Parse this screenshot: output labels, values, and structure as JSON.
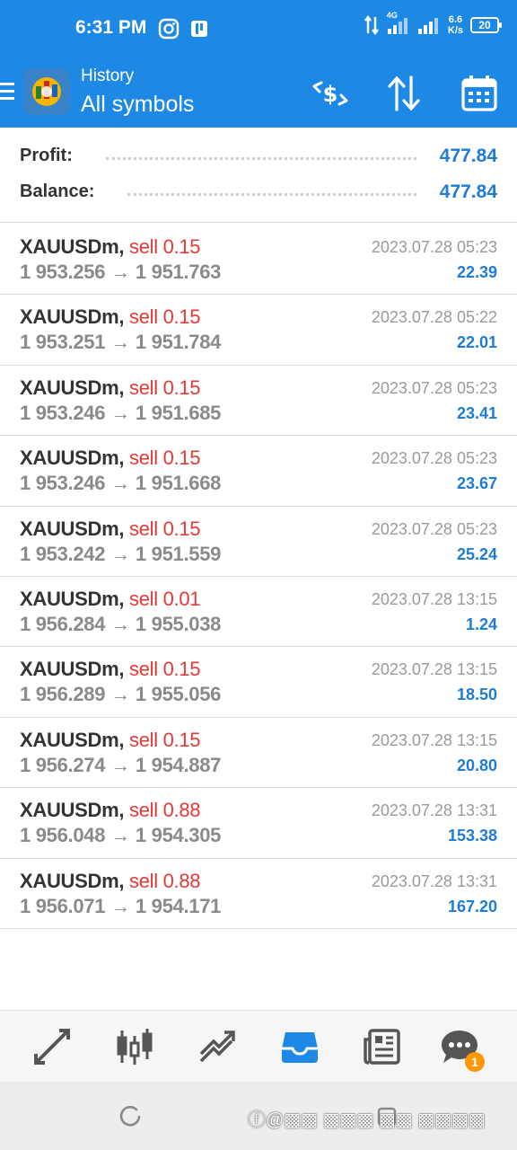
{
  "status_bar": {
    "time": "6:31 PM",
    "network": "4G",
    "speed_value": "6.6",
    "speed_unit": "K/s",
    "battery": "20"
  },
  "header": {
    "title": "History",
    "subtitle": "All symbols"
  },
  "summary": {
    "profit_label": "Profit:",
    "profit_value": "477.84",
    "balance_label": "Balance:",
    "balance_value": "477.84"
  },
  "trades": [
    {
      "symbol": "XAUUSDm,",
      "side": "sell 0.15",
      "open": "1 953.256",
      "close": "1 951.763",
      "date": "2023.07.28 05:23",
      "profit": "22.39"
    },
    {
      "symbol": "XAUUSDm,",
      "side": "sell 0.15",
      "open": "1 953.251",
      "close": "1 951.784",
      "date": "2023.07.28 05:22",
      "profit": "22.01"
    },
    {
      "symbol": "XAUUSDm,",
      "side": "sell 0.15",
      "open": "1 953.246",
      "close": "1 951.685",
      "date": "2023.07.28 05:23",
      "profit": "23.41"
    },
    {
      "symbol": "XAUUSDm,",
      "side": "sell 0.15",
      "open": "1 953.246",
      "close": "1 951.668",
      "date": "2023.07.28 05:23",
      "profit": "23.67"
    },
    {
      "symbol": "XAUUSDm,",
      "side": "sell 0.15",
      "open": "1 953.242",
      "close": "1 951.559",
      "date": "2023.07.28 05:23",
      "profit": "25.24"
    },
    {
      "symbol": "XAUUSDm,",
      "side": "sell 0.01",
      "open": "1 956.284",
      "close": "1 955.038",
      "date": "2023.07.28 13:15",
      "profit": "1.24"
    },
    {
      "symbol": "XAUUSDm,",
      "side": "sell 0.15",
      "open": "1 956.289",
      "close": "1 955.056",
      "date": "2023.07.28 13:15",
      "profit": "18.50"
    },
    {
      "symbol": "XAUUSDm,",
      "side": "sell 0.15",
      "open": "1 956.274",
      "close": "1 954.887",
      "date": "2023.07.28 13:15",
      "profit": "20.80"
    },
    {
      "symbol": "XAUUSDm,",
      "side": "sell 0.88",
      "open": "1 956.048",
      "close": "1 954.305",
      "date": "2023.07.28 13:31",
      "profit": "153.38"
    },
    {
      "symbol": "XAUUSDm,",
      "side": "sell 0.88",
      "open": "1 956.071",
      "close": "1 954.171",
      "date": "2023.07.28 13:31",
      "profit": "167.20"
    }
  ],
  "price_arrow": "→",
  "tabs": [
    {
      "name": "quotes",
      "icon": "arrows-diagonal-icon"
    },
    {
      "name": "chart",
      "icon": "candlestick-icon"
    },
    {
      "name": "trade",
      "icon": "trend-icon"
    },
    {
      "name": "history",
      "icon": "inbox-icon"
    },
    {
      "name": "news",
      "icon": "newspaper-icon"
    },
    {
      "name": "messages",
      "icon": "chat-icon",
      "badge": "1"
    }
  ],
  "colors": {
    "accent": "#1e88e5",
    "profit": "#1e7bd6",
    "sell": "#e53935",
    "badge": "#ff9800"
  },
  "watermark": "ⓕ@▩▩ ▩▩▩ ▩▩ ▩▩▩▩"
}
